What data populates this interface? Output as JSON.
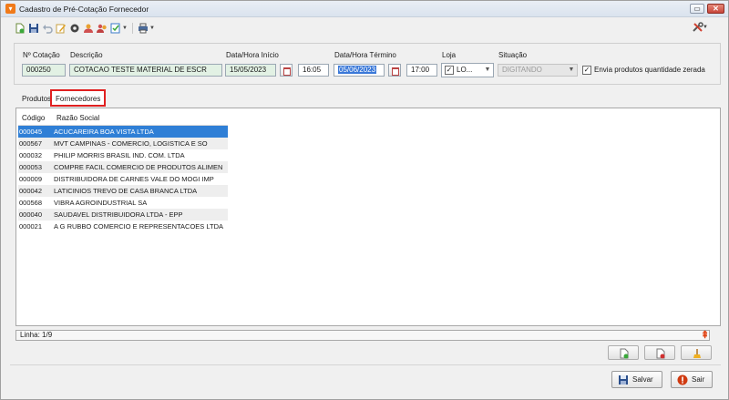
{
  "window": {
    "title": "Cadastro de Pré-Cotação Fornecedor",
    "minimize_glyph": "▭",
    "close_glyph": "✕"
  },
  "toolbar": {
    "icons": [
      "new-doc-icon",
      "save-icon",
      "undo-icon",
      "edit-icon",
      "gear-icon",
      "user-icon",
      "users-icon",
      "checklist-icon",
      "print-icon"
    ],
    "tools_icon": "tools-icon"
  },
  "header": {
    "cotacao": {
      "label": "Nº Cotação",
      "value": "000250"
    },
    "descricao": {
      "label": "Descrição",
      "value": "COTACAO TESTE MATERIAL DE ESCR"
    },
    "inicio": {
      "label": "Data/Hora Início",
      "date": "15/05/2023",
      "time": "16:05"
    },
    "termino": {
      "label": "Data/Hora Término",
      "date": "05/06/2023",
      "time": "17:00"
    },
    "loja": {
      "label": "Loja",
      "value": "LO...",
      "checked": true
    },
    "situacao": {
      "label": "Situação",
      "value": "DIGITANDO"
    },
    "envia_zerada": {
      "label": "Envia produtos quantidade zerada",
      "checked": true
    }
  },
  "tabs": [
    {
      "label": "Produtos",
      "active": false
    },
    {
      "label": "Fornecedores",
      "active": true
    }
  ],
  "grid": {
    "columns": [
      "Código",
      "Razão Social"
    ],
    "rows": [
      {
        "code": "000045",
        "name": "ACUCAREIRA BOA VISTA LTDA",
        "selected": true
      },
      {
        "code": "000567",
        "name": "MVT CAMPINAS - COMERCIO, LOGISTICA  E SO"
      },
      {
        "code": "000032",
        "name": "PHILIP MORRIS BRASIL IND. COM. LTDA"
      },
      {
        "code": "000053",
        "name": "COMPRE FACIL COMERCIO DE PRODUTOS ALIMEN"
      },
      {
        "code": "000009",
        "name": "DISTRIBUIDORA DE CARNES VALE DO MOGI IMP"
      },
      {
        "code": "000042",
        "name": "LATICINIOS TREVO DE CASA BRANCA LTDA"
      },
      {
        "code": "000568",
        "name": "VIBRA AGROINDUSTRIAL SA"
      },
      {
        "code": "000040",
        "name": "SAUDAVEL DISTRIBUIDORA LTDA - EPP"
      },
      {
        "code": "000021",
        "name": "A G RUBBO COMERCIO E REPRESENTACOES LTDA"
      }
    ]
  },
  "status": {
    "linha": "Linha: 1/9"
  },
  "buttons": {
    "salvar": "Salvar",
    "sair": "Sair"
  },
  "colors": {
    "selection": "#2f7fd6",
    "field_green": "#e2f1e4",
    "tab_highlight": "#e02020"
  }
}
